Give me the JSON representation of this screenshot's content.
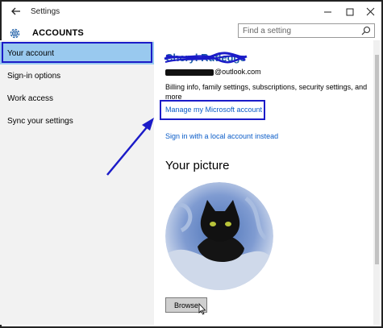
{
  "window": {
    "title": "Settings",
    "back_icon": "back-arrow-icon",
    "minimize_icon": "minimize-icon",
    "maximize_icon": "maximize-icon",
    "close_icon": "close-icon"
  },
  "header": {
    "icon": "gear-icon",
    "title": "ACCOUNTS",
    "search_placeholder": "Find a setting",
    "search_icon": "search-icon"
  },
  "sidebar": {
    "items": [
      {
        "label": "Your account",
        "active": true
      },
      {
        "label": "Sign-in options",
        "active": false
      },
      {
        "label": "Work access",
        "active": false
      },
      {
        "label": "Sync your settings",
        "active": false
      }
    ]
  },
  "account": {
    "name": "Cheryl Rutledge",
    "email_suffix": "@outlook.com",
    "description": "Billing info, family settings, subscriptions, security settings, and more",
    "manage_link": "Manage my Microsoft account",
    "local_link": "Sign in with a local account instead"
  },
  "picture": {
    "title": "Your picture",
    "browse_label": "Browse"
  },
  "colors": {
    "accent": "#1e5fa8",
    "link": "#0a5cc8",
    "sidebar_bg": "#f2f2f2",
    "selected_bg": "#99c9ef",
    "annotation": "#1b1bc8"
  }
}
